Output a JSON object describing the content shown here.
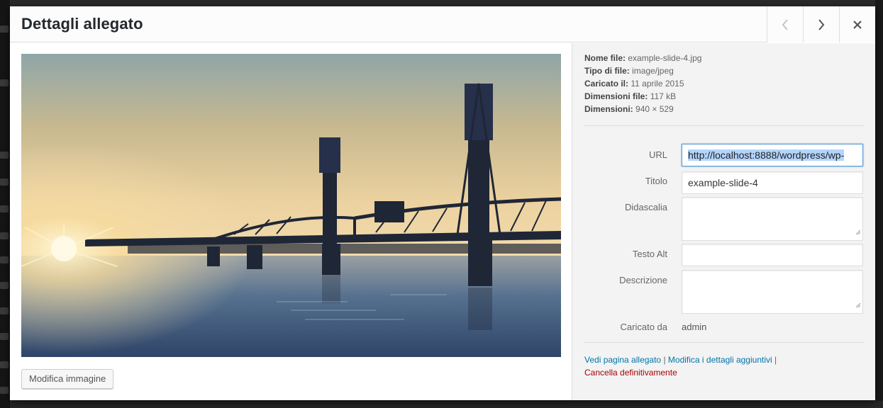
{
  "modal": {
    "title": "Dettagli allegato"
  },
  "image": {
    "alt": "Hawthorne Bridge at sunset over the river"
  },
  "edit_image_label": "Modifica immagine",
  "file_info": [
    {
      "label": "Nome file:",
      "value": "example-slide-4.jpg"
    },
    {
      "label": "Tipo di file:",
      "value": "image/jpeg"
    },
    {
      "label": "Caricato il:",
      "value": "11 aprile 2015"
    },
    {
      "label": "Dimensioni file:",
      "value": "117 kB"
    },
    {
      "label": "Dimensioni:",
      "value": "940 × 529"
    }
  ],
  "fields": {
    "url_label": "URL",
    "url_value": "http://localhost:8888/wordpress/wp-",
    "title_label": "Titolo",
    "title_value": "example-slide-4",
    "caption_label": "Didascalia",
    "alt_label": "Testo Alt",
    "description_label": "Descrizione",
    "uploaded_by_label": "Caricato da",
    "uploaded_by_value": "admin"
  },
  "actions": {
    "view_page": "Vedi pagina allegato",
    "edit_more": "Modifica i dettagli aggiuntivi",
    "separator": "|",
    "delete": "Cancella definitivamente"
  },
  "colors": {
    "link": "#0073aa",
    "danger": "#a00000",
    "focus_border": "#5b9dd9",
    "selection": "#b3d4fc"
  }
}
